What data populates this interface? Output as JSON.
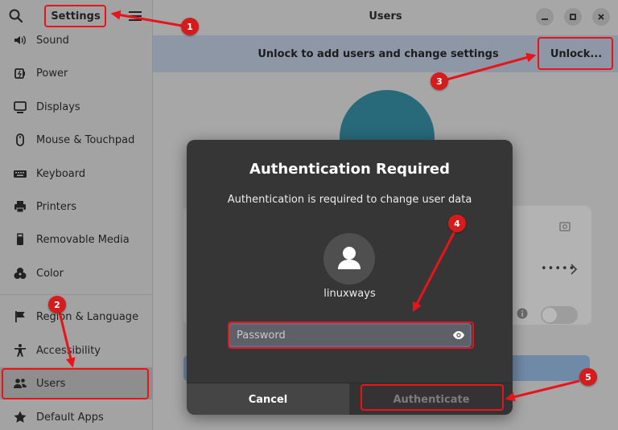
{
  "sidebar": {
    "title": "Settings",
    "items": [
      {
        "label": "Sound",
        "icon": "speaker-icon"
      },
      {
        "label": "Power",
        "icon": "power-icon"
      },
      {
        "label": "Displays",
        "icon": "display-icon"
      },
      {
        "label": "Mouse & Touchpad",
        "icon": "mouse-icon"
      },
      {
        "label": "Keyboard",
        "icon": "keyboard-icon"
      },
      {
        "label": "Printers",
        "icon": "printer-icon"
      },
      {
        "label": "Removable Media",
        "icon": "usb-icon"
      },
      {
        "label": "Color",
        "icon": "color-icon"
      },
      {
        "label": "Region & Language",
        "icon": "flag-icon"
      },
      {
        "label": "Accessibility",
        "icon": "accessibility-icon"
      },
      {
        "label": "Users",
        "icon": "users-icon",
        "selected": true
      },
      {
        "label": "Default Apps",
        "icon": "star-icon"
      }
    ]
  },
  "window": {
    "title": "Users"
  },
  "infobar": {
    "text": "Unlock to add users and change settings",
    "unlock_label": "Unlock..."
  },
  "user_panel": {
    "password_dots": "•••••"
  },
  "dialog": {
    "title": "Authentication Required",
    "message": "Authentication is required to change user data",
    "username": "linuxways",
    "password_placeholder": "Password",
    "cancel_label": "Cancel",
    "authenticate_label": "Authenticate"
  },
  "annotations": {
    "badges": [
      "1",
      "2",
      "3",
      "4",
      "5"
    ],
    "color": "#e8141a"
  },
  "colors": {
    "dialog_bg": "#363636",
    "avatar_teal": "#28697a",
    "infobar_bg": "#8d97a6"
  }
}
